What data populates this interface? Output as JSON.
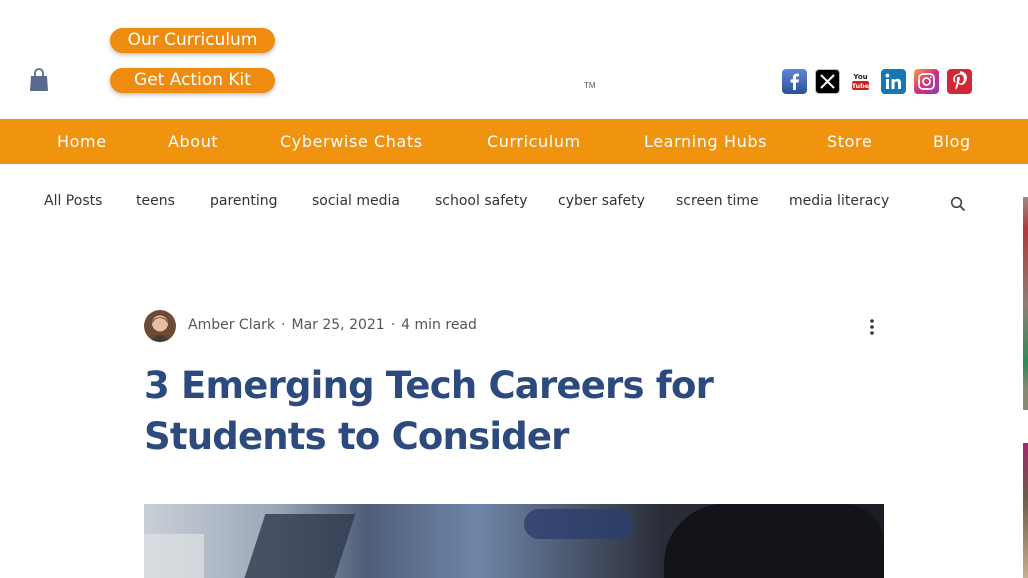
{
  "header": {
    "buttons": [
      "Our Curriculum",
      "Get Action Kit"
    ],
    "trademark": "TM",
    "socials": [
      "facebook-icon",
      "x-icon",
      "youtube-icon",
      "linkedin-icon",
      "instagram-icon",
      "pinterest-icon"
    ]
  },
  "nav": {
    "items": [
      "Home",
      "About",
      "Cyberwise Chats",
      "Curriculum",
      "Learning Hubs",
      "Store",
      "Blog"
    ],
    "color": "#f0930f"
  },
  "categories": [
    "All Posts",
    "teens",
    "parenting",
    "social media",
    "school safety",
    "cyber safety",
    "screen time",
    "media literacy"
  ],
  "post": {
    "author": "Amber Clark",
    "date": "Mar 25, 2021",
    "read_time": "4 min read",
    "title": "3 Emerging Tech Careers for Students to Consider"
  },
  "colors": {
    "accent": "#ef8b0f",
    "title": "#2c4a7e"
  }
}
